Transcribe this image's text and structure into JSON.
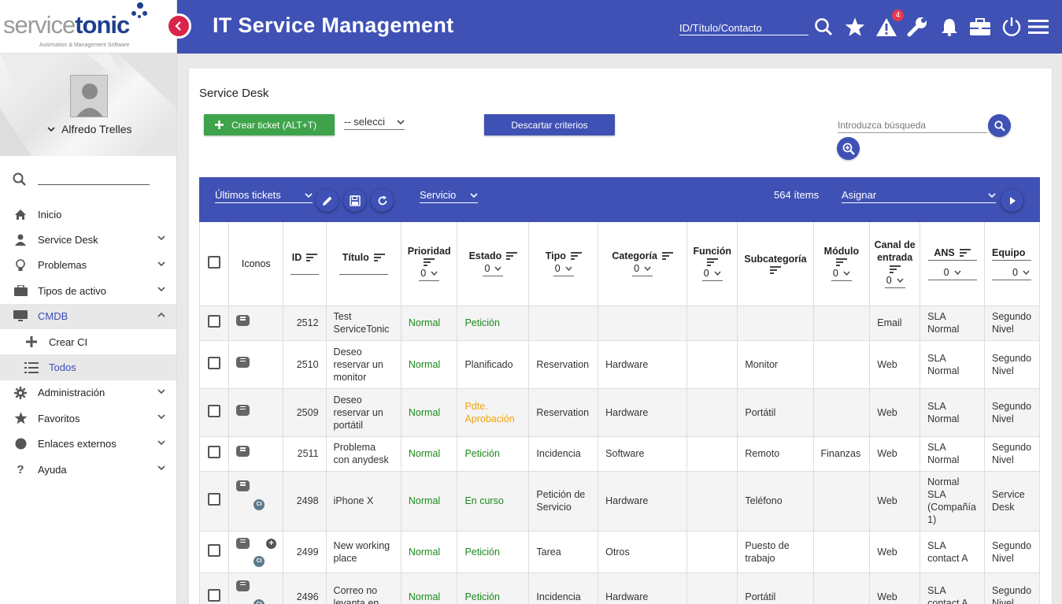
{
  "logo": {
    "part1": "service",
    "part2": "tonic",
    "tagline": "Automation & Management Software"
  },
  "header": {
    "title": "IT Service Management",
    "search_placeholder": "ID/Título/Contacto",
    "alert_count": "4"
  },
  "profile": {
    "name": "Alfredo Trelles"
  },
  "sidebar": {
    "items": [
      {
        "label": "Inicio",
        "icon": "home-icon"
      },
      {
        "label": "Service Desk",
        "icon": "user-icon"
      },
      {
        "label": "Problemas",
        "icon": "lightbulb-icon"
      },
      {
        "label": "Tipos de activo",
        "icon": "briefcase-icon"
      },
      {
        "label": "CMDB",
        "icon": "monitor-icon"
      },
      {
        "label": "Crear CI",
        "icon": "plus-icon"
      },
      {
        "label": "Todos",
        "icon": "list-icon"
      },
      {
        "label": "Administración",
        "icon": "gear-icon"
      },
      {
        "label": "Favoritos",
        "icon": "star-icon"
      },
      {
        "label": "Enlaces externos",
        "icon": "circle-icon"
      },
      {
        "label": "Ayuda",
        "icon": "question-icon"
      }
    ]
  },
  "main": {
    "title": "Service Desk",
    "create_button": "Crear ticket (ALT+T)",
    "filter_select": "-- selecci",
    "discard_button": "Descartar criterios",
    "search_placeholder": "Introduzca búsqueda"
  },
  "toolbar": {
    "view_select": "Últimos tickets",
    "service_select": "Servicio",
    "items_count": "564 ítems",
    "assign_select": "Asignar"
  },
  "table": {
    "headers": {
      "icons": "Iconos",
      "id": "ID",
      "title": "Título",
      "priority": "Prioridad",
      "status": "Estado",
      "type": "Tipo",
      "category": "Categoría",
      "function": "Función",
      "subcategory": "Subcategoría",
      "module": "Módulo",
      "channel": "Canal de entrada",
      "sla": "ANS",
      "team": "Equipo"
    },
    "filter_zero": "0",
    "rows": [
      {
        "id": "2512",
        "title": "Test ServiceTonic",
        "priority": "Normal",
        "status": "Petición",
        "type": "",
        "category": "",
        "function": "",
        "subcategory": "",
        "module": "",
        "channel": "Email",
        "sla": "SLA Normal",
        "team": "Segundo Nivel"
      },
      {
        "id": "2510",
        "title": "Deseo reservar un monitor",
        "priority": "Normal",
        "status": "Planificado",
        "type": "Reservation",
        "category": "Hardware",
        "function": "",
        "subcategory": "Monitor",
        "module": "",
        "channel": "Web",
        "sla": "SLA Normal",
        "team": "Segundo Nivel"
      },
      {
        "id": "2509",
        "title": "Deseo reservar un portátil",
        "priority": "Normal",
        "status": "Pdte. Aprobación",
        "type": "Reservation",
        "category": "Hardware",
        "function": "",
        "subcategory": "Portátil",
        "module": "",
        "channel": "Web",
        "sla": "SLA Normal",
        "team": "Segundo Nivel"
      },
      {
        "id": "2511",
        "title": "Problema con anydesk",
        "priority": "Normal",
        "status": "Petición",
        "type": "Incidencia",
        "category": "Software",
        "function": "",
        "subcategory": "Remoto",
        "module": "Finanzas",
        "channel": "Web",
        "sla": "SLA Normal",
        "team": "Segundo Nivel"
      },
      {
        "id": "2498",
        "title": "iPhone X",
        "priority": "Normal",
        "status": "En curso",
        "type": "Petición de Servicio",
        "category": "Hardware",
        "function": "",
        "subcategory": "Teléfono",
        "module": "",
        "channel": "Web",
        "sla": "Normal SLA (Compañía 1)",
        "team": "Service Desk"
      },
      {
        "id": "2499",
        "title": "New working place",
        "priority": "Normal",
        "status": "Petición",
        "type": "Tarea",
        "category": "Otros",
        "function": "",
        "subcategory": "Puesto de trabajo",
        "module": "",
        "channel": "Web",
        "sla": "SLA contact A",
        "team": "Segundo Nivel"
      },
      {
        "id": "2496",
        "title": "Correo no levanta en",
        "priority": "Normal",
        "status": "Petición",
        "type": "Incidencia",
        "category": "Hardware",
        "function": "",
        "subcategory": "Portátil",
        "module": "",
        "channel": "Web",
        "sla": "SLA contact A",
        "team": "Segundo Nivel"
      }
    ]
  },
  "colors": {
    "primary": "#3f51b5",
    "success": "#3ea34a",
    "accent_red": "#d9254b",
    "status_green": "#1a8a1a",
    "status_orange": "#f0a30a"
  }
}
